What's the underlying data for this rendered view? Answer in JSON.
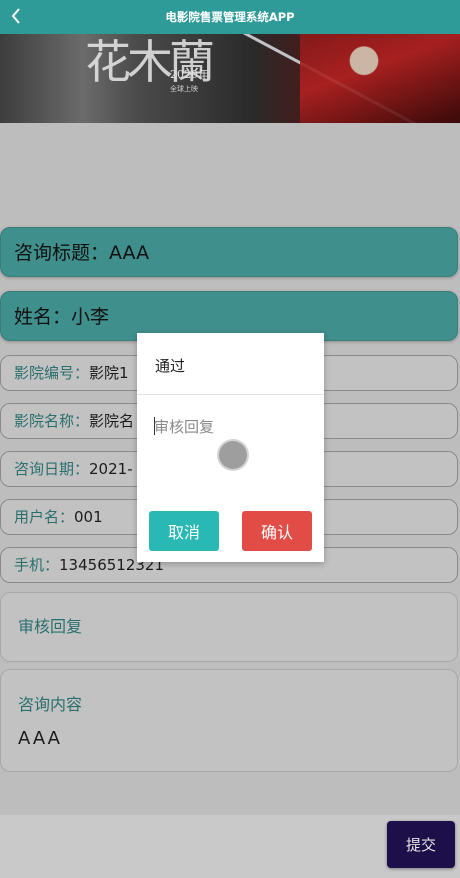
{
  "header": {
    "title": "电影院售票管理系统APP",
    "back_icon": "chevron-left-icon"
  },
  "banner": {
    "calligraphy": "花木蘭",
    "year_text": "2020年",
    "sub_text": "全球上映"
  },
  "fields": {
    "consult_title": {
      "label": "咨询标题：",
      "value": "AAA"
    },
    "name": {
      "label": "姓名：",
      "value": "小李"
    },
    "cinema_no": {
      "label": "影院编号：",
      "value": "影院1"
    },
    "cinema_name": {
      "label": "影院名称：",
      "value": "影院名"
    },
    "consult_date": {
      "label": "咨询日期：",
      "value": "2021-"
    },
    "username": {
      "label": "用户名：",
      "value": "001"
    },
    "phone": {
      "label": "手机：",
      "value": "13456512321"
    }
  },
  "review_reply": {
    "label": "审核回复"
  },
  "consult_content": {
    "label": "咨询内容",
    "value": "AAA"
  },
  "submit_label": "提交",
  "dialog": {
    "title": "通过",
    "reply_placeholder": "审核回复",
    "cancel_label": "取消",
    "confirm_label": "确认"
  },
  "colors": {
    "accent": "#2f9b98",
    "cancel": "#29b8b3",
    "confirm": "#e14c47",
    "submit": "#1d0f4a"
  }
}
